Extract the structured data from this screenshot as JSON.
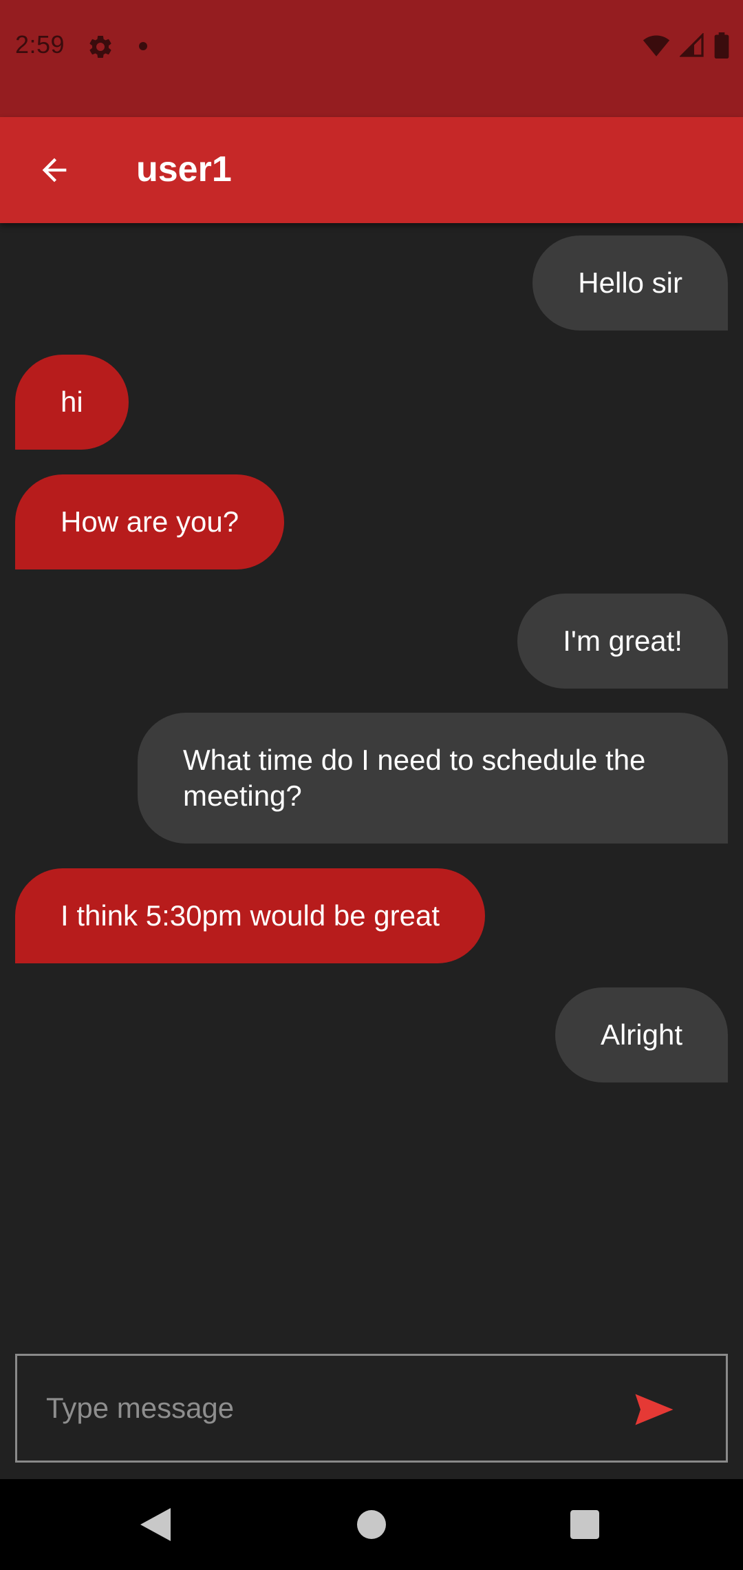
{
  "status_bar": {
    "time": "2:59",
    "icons": [
      "gear-icon",
      "dot-icon",
      "wifi-icon",
      "signal-icon",
      "battery-icon"
    ]
  },
  "app_bar": {
    "title": "user1",
    "back_icon": "arrow-left-icon"
  },
  "messages": [
    {
      "side": "sent",
      "text": "Hello sir"
    },
    {
      "side": "received",
      "text": "hi"
    },
    {
      "side": "received",
      "text": "How are you?"
    },
    {
      "side": "sent",
      "text": "I'm great!"
    },
    {
      "side": "sent",
      "text": "What time do I need to schedule the meeting?"
    },
    {
      "side": "received",
      "text": "I think 5:30pm would be great"
    },
    {
      "side": "sent",
      "text": "Alright"
    }
  ],
  "composer": {
    "placeholder": "Type message",
    "value": "",
    "send_icon": "send-icon"
  },
  "nav_bar": {
    "icons": [
      "back-triangle-icon",
      "home-circle-icon",
      "recents-square-icon"
    ]
  },
  "colors": {
    "status_bar": "#951d20",
    "app_bar": "#c62828",
    "background": "#212121",
    "sent_bubble": "#3c3c3c",
    "received_bubble": "#b71c1c",
    "send_icon": "#e53935"
  }
}
